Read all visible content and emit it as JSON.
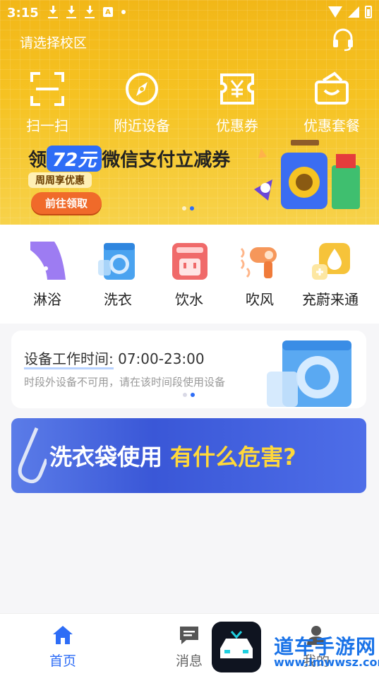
{
  "status_bar": {
    "time": "3:15",
    "a_badge": "A"
  },
  "header": {
    "campus_label": "请选择校区",
    "support_icon": "headset-icon"
  },
  "quick_actions": [
    {
      "label": "扫一扫",
      "icon": "scan-icon"
    },
    {
      "label": "附近设备",
      "icon": "compass-icon"
    },
    {
      "label": "优惠券",
      "icon": "coupon-icon"
    },
    {
      "label": "优惠套餐",
      "icon": "package-icon"
    }
  ],
  "promo_banner": {
    "title_prefix": "领",
    "amount": "72元",
    "title_suffix": "微信支付立减券",
    "subtitle": "周周享优惠",
    "button": "前往领取",
    "pagination": {
      "count": 2,
      "active": 1
    }
  },
  "services": [
    {
      "label": "淋浴",
      "icon": "shower-icon"
    },
    {
      "label": "洗衣",
      "icon": "washer-icon"
    },
    {
      "label": "饮水",
      "icon": "water-dispenser-icon"
    },
    {
      "label": "吹风",
      "icon": "hair-dryer-icon"
    },
    {
      "label": "充蔚来通",
      "icon": "recharge-drop-icon"
    }
  ],
  "notice_card": {
    "title_label": "设备工作时间:",
    "hours": "07:00-23:00",
    "subtitle": "时段外设备不可用，请在该时间段使用设备",
    "pagination": {
      "count": 2,
      "active": 1
    }
  },
  "article_banner": {
    "text_white": "洗衣袋使用",
    "text_yellow": "有什么危害?"
  },
  "tab_bar": [
    {
      "label": "首页",
      "icon": "home-icon",
      "active": true
    },
    {
      "label": "消息",
      "icon": "message-icon",
      "active": false
    },
    {
      "label": "我的",
      "icon": "user-icon",
      "active": false
    }
  ],
  "watermark": {
    "name": "道车手游网",
    "url": "www.lmwwsz.com"
  },
  "colors": {
    "hero_yellow": "#f6c323",
    "accent_blue": "#2e6df6",
    "promo_orange": "#f06a2a",
    "article_blue": "#3a57d7"
  }
}
